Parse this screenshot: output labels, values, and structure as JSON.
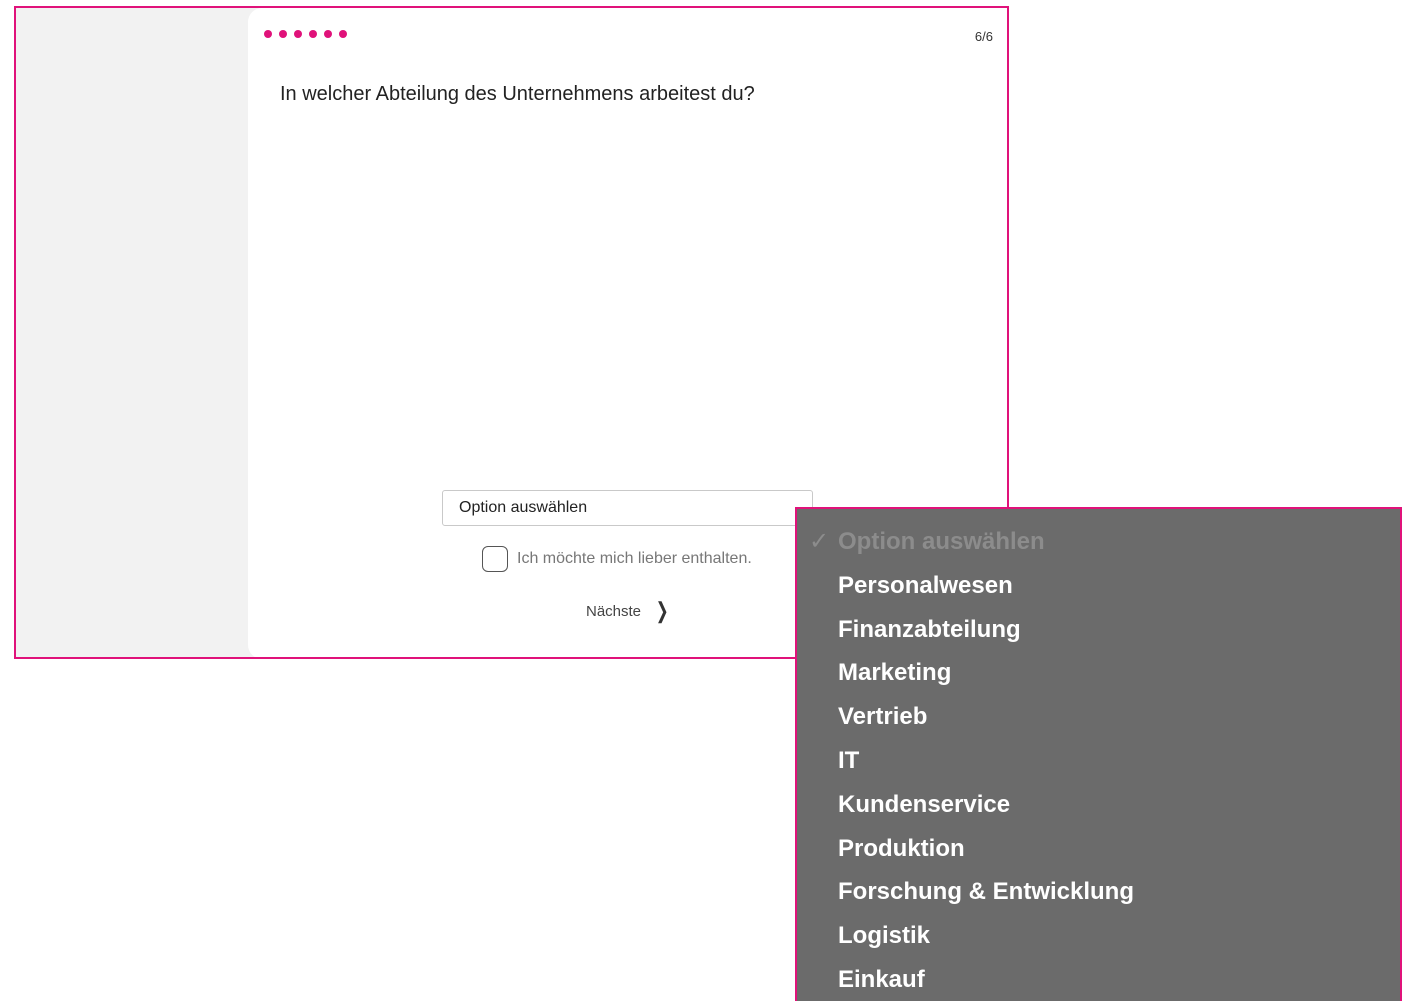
{
  "progress": {
    "dot_count": 6,
    "counter": "6/6",
    "accent_color": "#e0127a"
  },
  "question": {
    "text": "In welcher Abteilung des Unternehmens arbeitest du?"
  },
  "select": {
    "selected_value": "Option auswählen",
    "chevron_icon": "chevron-down-icon"
  },
  "abstain": {
    "label": "Ich möchte mich lieber enthalten.",
    "checked": false
  },
  "next": {
    "label": "Nächste",
    "icon": "chevron-right-icon"
  },
  "dropdown": {
    "check_mark": "✓",
    "items": [
      {
        "label": "Option auswählen",
        "selected": true,
        "placeholder": true
      },
      {
        "label": "Personalwesen"
      },
      {
        "label": "Finanzabteilung"
      },
      {
        "label": "Marketing"
      },
      {
        "label": "Vertrieb"
      },
      {
        "label": "IT"
      },
      {
        "label": "Kundenservice"
      },
      {
        "label": "Produktion"
      },
      {
        "label": "Forschung & Entwicklung"
      },
      {
        "label": "Logistik"
      },
      {
        "label": "Einkauf"
      }
    ]
  }
}
